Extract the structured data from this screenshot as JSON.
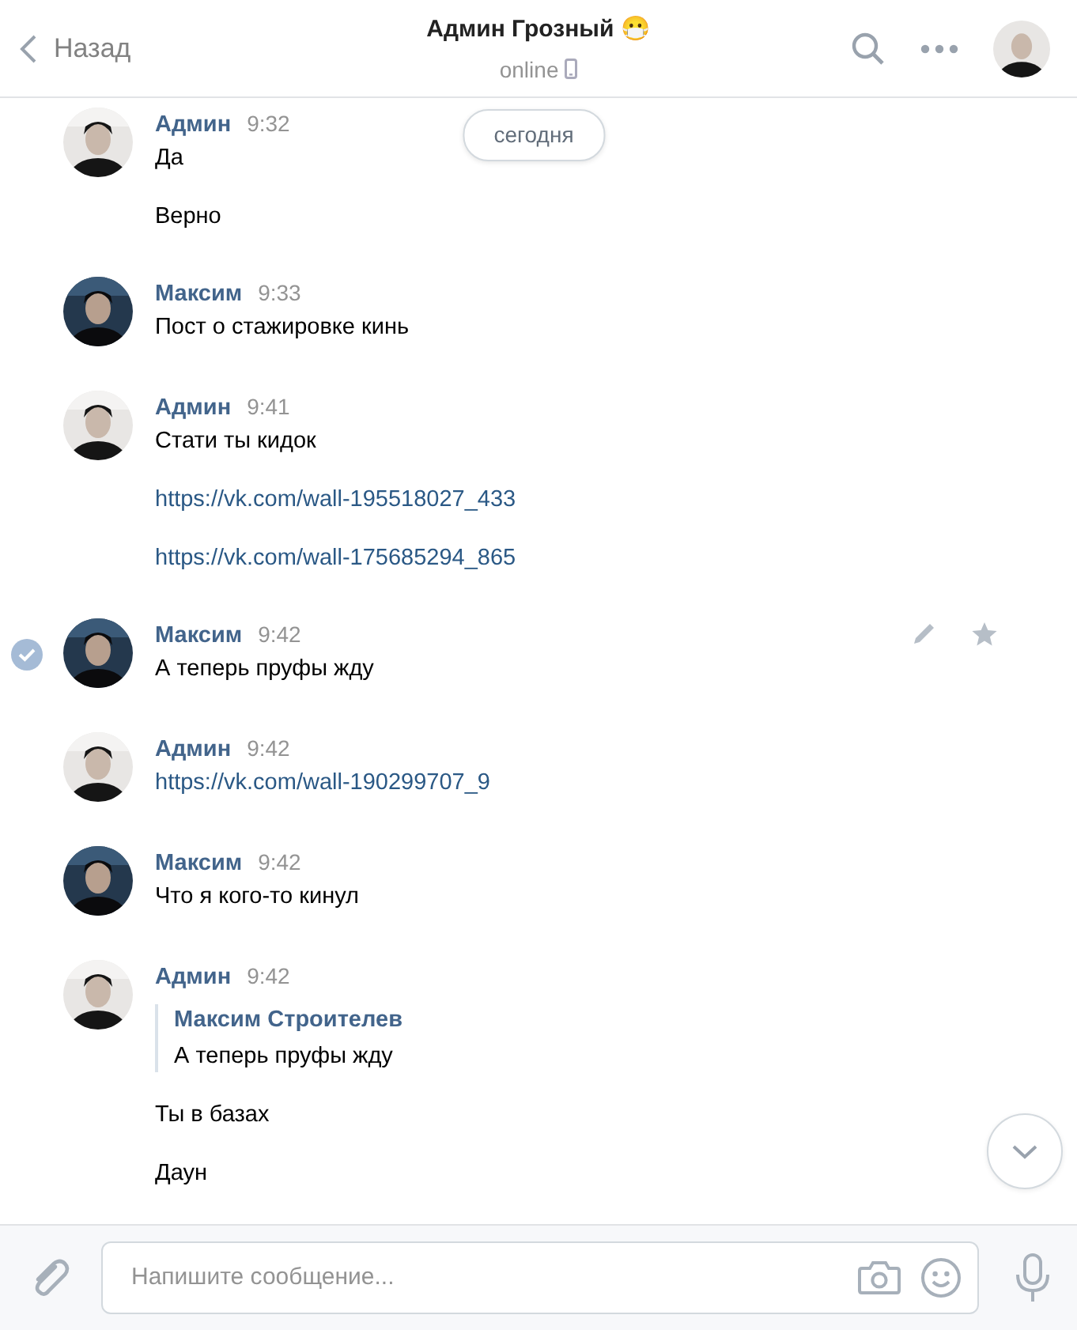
{
  "header": {
    "back": "Назад",
    "title": "Админ Грозный",
    "title_emoji": "😷",
    "status": "online"
  },
  "date_pill": "сегодня",
  "messages": [
    {
      "author": "Админ",
      "kind": "admin",
      "time": "9:32",
      "selected": false,
      "parts": [
        {
          "kind": "text",
          "text": "Да"
        },
        {
          "kind": "text",
          "text": "Верно"
        }
      ]
    },
    {
      "author": "Максим",
      "kind": "maksim",
      "time": "9:33",
      "selected": false,
      "parts": [
        {
          "kind": "text",
          "text": "Пост о стажировке кинь"
        }
      ]
    },
    {
      "author": "Админ",
      "kind": "admin",
      "time": "9:41",
      "selected": false,
      "parts": [
        {
          "kind": "text",
          "text": "Стати ты кидок"
        },
        {
          "kind": "link",
          "text": "https://vk.com/wall-195518027_433"
        },
        {
          "kind": "link",
          "text": "https://vk.com/wall-175685294_865"
        }
      ]
    },
    {
      "author": "Максим",
      "kind": "maksim",
      "time": "9:42",
      "selected": true,
      "parts": [
        {
          "kind": "text",
          "text": "А теперь пруфы жду"
        }
      ]
    },
    {
      "author": "Админ",
      "kind": "admin",
      "time": "9:42",
      "selected": false,
      "parts": [
        {
          "kind": "link",
          "text": "https://vk.com/wall-190299707_9"
        }
      ]
    },
    {
      "author": "Максим",
      "kind": "maksim",
      "time": "9:42",
      "selected": false,
      "parts": [
        {
          "kind": "text",
          "text": "Что я кого-то кинул"
        }
      ]
    },
    {
      "author": "Админ",
      "kind": "admin",
      "time": "9:42",
      "selected": false,
      "parts": [
        {
          "kind": "quote",
          "author": "Максим Строителев",
          "text": "А теперь пруфы жду"
        },
        {
          "kind": "text",
          "text": "Ты в базах"
        },
        {
          "kind": "text",
          "text": "Даун"
        }
      ]
    }
  ],
  "composer": {
    "placeholder": "Напишите сообщение..."
  }
}
